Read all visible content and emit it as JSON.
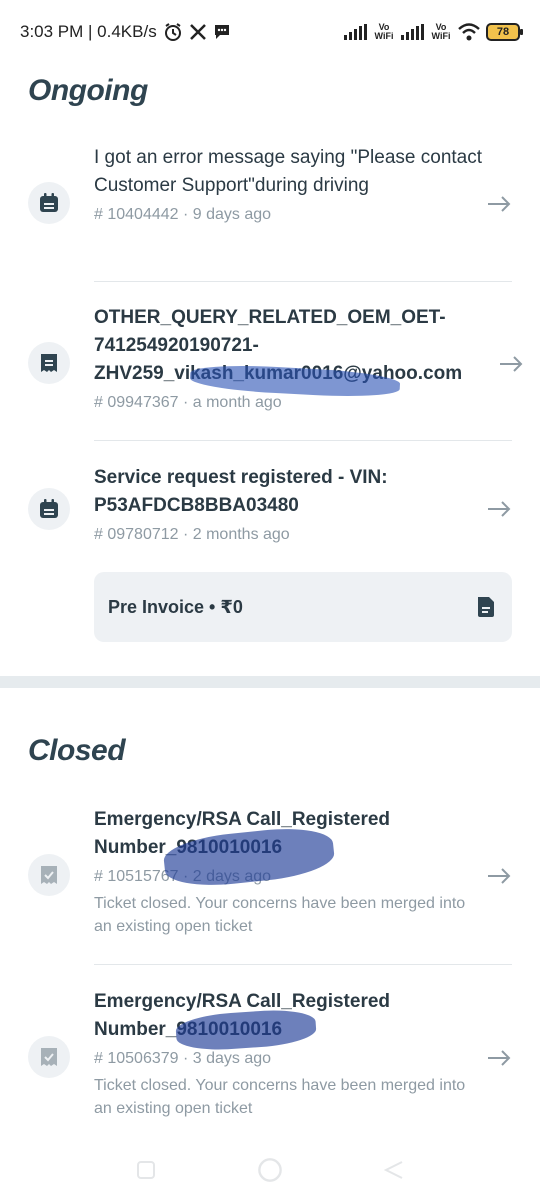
{
  "status_bar": {
    "time_speed": "3:03 PM | 0.4KB/s",
    "network_label_1": "Vo WiFi",
    "network_label_2": "Vo WiFi",
    "battery": "78"
  },
  "ongoing": {
    "title": "Ongoing",
    "tickets": [
      {
        "title": "I got an error message saying \"Please contact Customer Support\"during driving",
        "meta": "# 10404442 · 9 days ago",
        "icon": "calendar-icon"
      },
      {
        "title": "OTHER_QUERY_RELATED_OEM_OET-741254920190721-ZHV259_vikash_kumar0016@yahoo.com",
        "meta": "# 09947367 · a month ago",
        "icon": "receipt-icon"
      },
      {
        "title": "Service request registered - VIN: P53AFDCB8BBA03480",
        "meta": "# 09780712 · 2 months ago",
        "icon": "calendar-icon"
      }
    ],
    "invoice": {
      "label": "Pre Invoice • ₹0",
      "icon": "document-icon"
    }
  },
  "closed": {
    "title": "Closed",
    "tickets": [
      {
        "title": "Emergency/RSA Call_Registered Number_9810010016",
        "meta": "# 10515767 · 2 days ago",
        "note": "Ticket closed. Your concerns have been merged into an existing open ticket",
        "icon": "receipt-check-icon"
      },
      {
        "title": "Emergency/RSA Call_Registered Number_9810010016",
        "meta": "# 10506379 · 3 days ago",
        "note": "Ticket closed. Your concerns have been merged into an existing open ticket",
        "icon": "receipt-check-icon"
      }
    ]
  },
  "colors": {
    "heading": "#2f4450",
    "meta": "#8e9aa3",
    "icon_bg": "#eef1f4",
    "section_band": "#e6ebee"
  }
}
